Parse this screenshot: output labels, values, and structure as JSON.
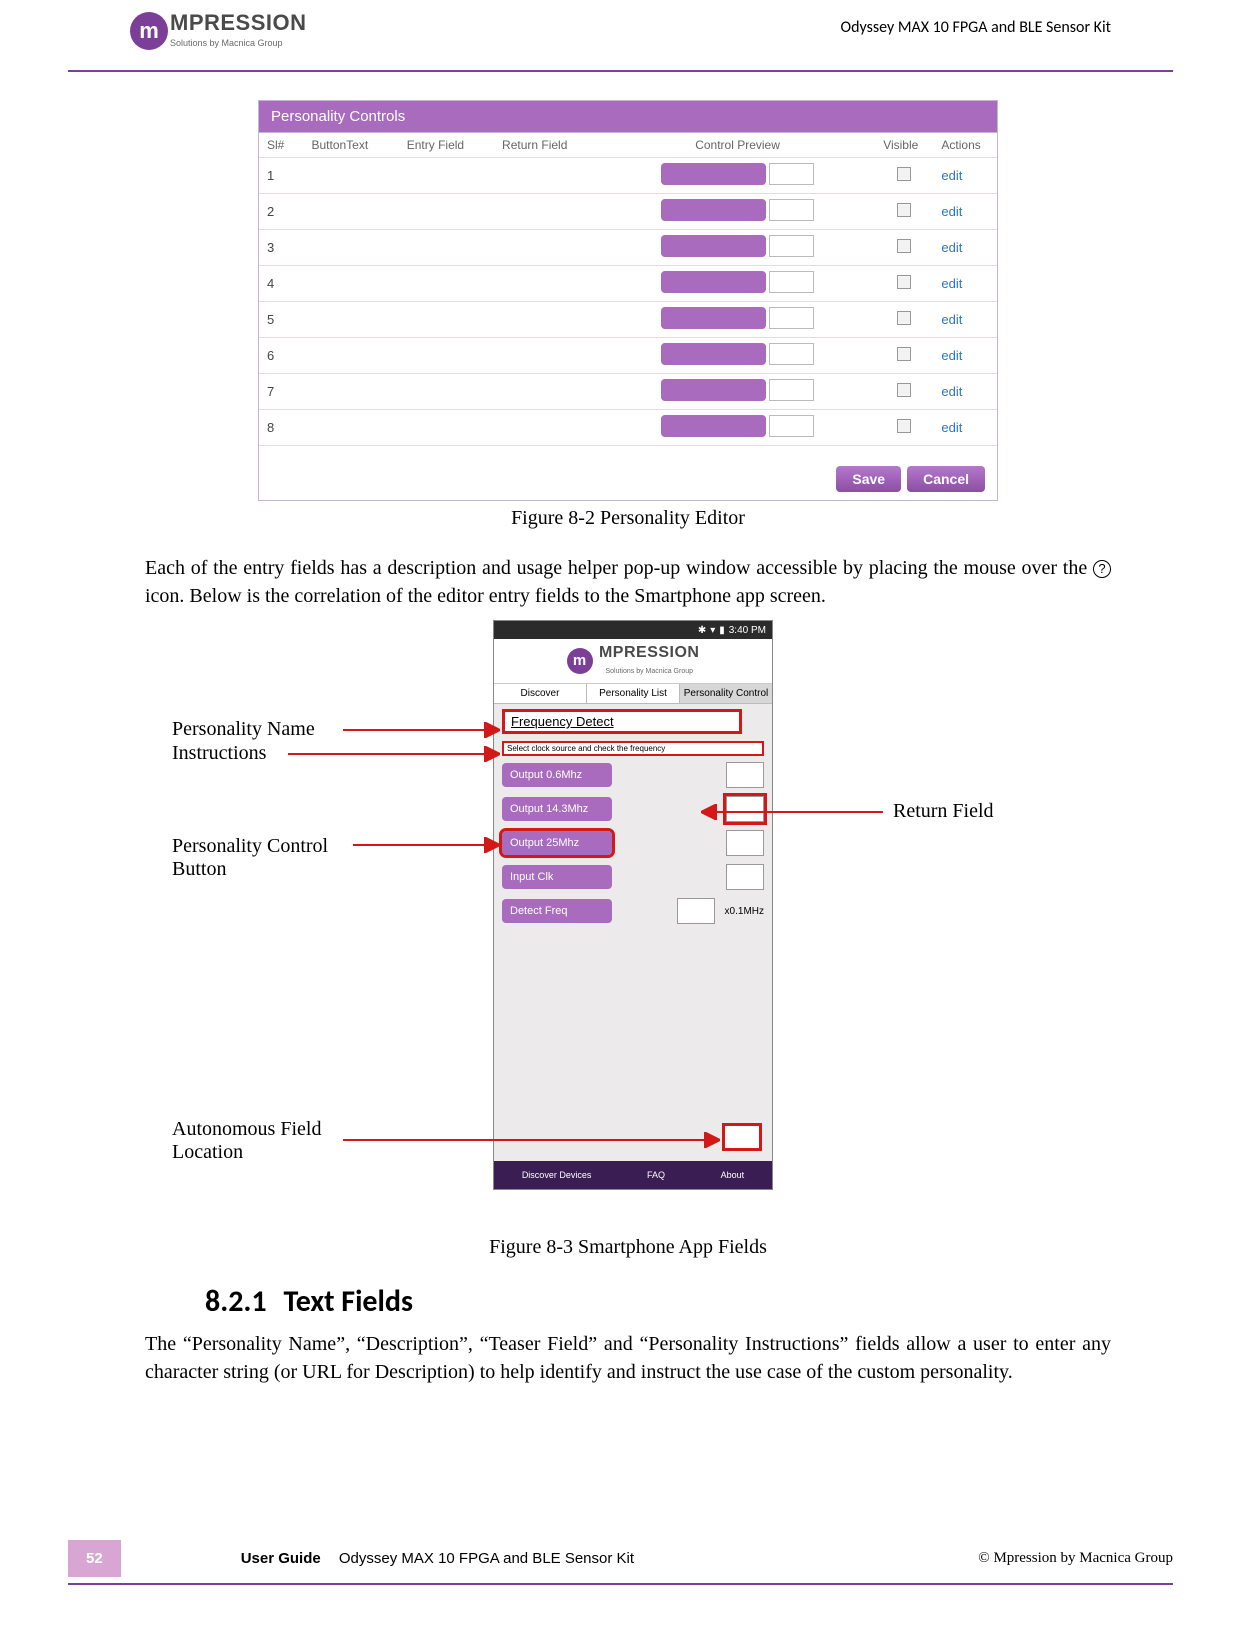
{
  "header": {
    "brand": "MPRESSION",
    "tagline": "Solutions by Macnica Group",
    "doc_title": "Odyssey MAX 10 FPGA and BLE Sensor Kit"
  },
  "editor": {
    "title": "Personality Controls",
    "columns": [
      "Sl#",
      "ButtonText",
      "Entry Field",
      "Return Field",
      "Control Preview",
      "Visible",
      "Actions"
    ],
    "rows": [
      "1",
      "2",
      "3",
      "4",
      "5",
      "6",
      "7",
      "8"
    ],
    "edit_label": "edit",
    "save_label": "Save",
    "cancel_label": "Cancel"
  },
  "fig1_caption": "Figure 8-2 Personality Editor",
  "para1a": "Each of the entry fields has a description and usage helper pop-up window accessible by placing the mouse over the ",
  "para1b": " icon.   Below is the correlation of the editor entry fields to the Smartphone app screen.",
  "phone": {
    "status_time": "3:40 PM",
    "tabs": [
      "Discover",
      "Personality List",
      "Personality Control"
    ],
    "personality_name": "Frequency Detect",
    "instructions": "Select clock source and check the frequency",
    "rows": [
      {
        "label": "Output 0.6Mhz"
      },
      {
        "label": "Output 14.3Mhz"
      },
      {
        "label": "Output 25Mhz"
      },
      {
        "label": "Input Clk"
      },
      {
        "label": "Detect Freq",
        "suffix": "x0.1MHz"
      }
    ],
    "nav": [
      "Discover Devices",
      "FAQ",
      "About"
    ]
  },
  "callouts": {
    "personality_name": "Personality Name",
    "instructions": "Instructions",
    "control_button": "Personality Control Button",
    "return_field": "Return Field",
    "auto_field": "Autonomous Field Location"
  },
  "fig2_caption": "Figure 8-3 Smartphone App Fields",
  "section": {
    "number": "8.2.1",
    "title": "Text Fields"
  },
  "para2": "The “Personality Name”, “Description”, “Teaser Field” and “Personality Instructions” fields allow a user to enter any character string (or URL for Description) to help identify and instruct the use case of the custom personality.",
  "footer": {
    "page_number": "52",
    "guide_label": "User Guide",
    "kit_label": "Odyssey MAX 10 FPGA and BLE Sensor Kit",
    "copyright": "©  Mpression  by  Macnica  Group"
  }
}
